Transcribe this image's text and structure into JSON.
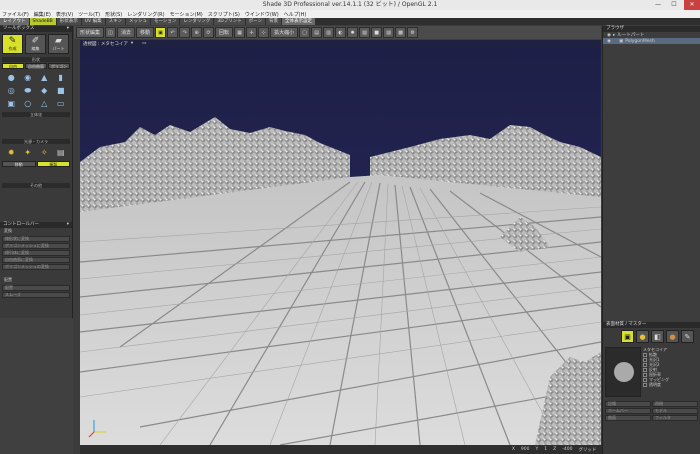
{
  "window": {
    "title": "Shade 3D Professional ver.14.1.1 (32 ビット) / OpenGL 2.1"
  },
  "menu": [
    "ファイル(F)",
    "編集(E)",
    "表示(V)",
    "ツール(T)",
    "形状(S)",
    "レンダリング(R)",
    "モーション(M)",
    "スクリプト(S)",
    "ウインドウ(W)",
    "ヘルプ(H)"
  ],
  "tabs": [
    {
      "label": "レイアウト",
      "state": "on"
    },
    {
      "label": "ShadeBB",
      "state": "hl"
    },
    {
      "label": "形状表示",
      "state": ""
    },
    {
      "label": "UV 編集",
      "state": ""
    },
    {
      "label": "スキン",
      "state": ""
    },
    {
      "label": "メッシュ",
      "state": ""
    },
    {
      "label": "モーション",
      "state": ""
    },
    {
      "label": "レンダリング",
      "state": ""
    },
    {
      "label": "3Dプリント",
      "state": ""
    },
    {
      "label": "ボーン",
      "state": ""
    },
    {
      "label": "背景",
      "state": ""
    },
    {
      "label": "全体表示設定",
      "state": "on"
    }
  ],
  "toolbox": {
    "header": "ツールボックス",
    "big_buttons": [
      "作成",
      "編集",
      "パート"
    ],
    "section_basic": "形状",
    "toggles": [
      "自由",
      "自由曲面",
      "ポリゴン"
    ],
    "section_solid": "立体化",
    "section_light": "光源・カメラ",
    "mode_toggles": [
      "移動",
      "複製"
    ],
    "section_bottom": "その他"
  },
  "left_lower": {
    "header": "コントロールバー",
    "section1": "変換",
    "rows1": [
      "線形状に変換",
      "ポリゴンメッシュに変換",
      "掃引体に変換",
      "自由曲面に変換",
      "ポリゴンメッシュの変換"
    ],
    "section2": "配置",
    "rows2": [
      "配置",
      "スムーズ"
    ]
  },
  "toolbar": {
    "items": [
      "形状編集",
      "消去",
      "移動",
      "回転",
      "拡大縮小"
    ],
    "active": "移動"
  },
  "viewport": {
    "label": "透視図 : メタセコイア"
  },
  "status": {
    "x": "X",
    "x_val": "900",
    "y": "Y",
    "y_val": "1",
    "z": "Z",
    "z_val": "-400",
    "grid_label": "グリッド",
    "grid_val": "1272",
    "unit_label": "mm",
    "snap": "スナップ",
    "snap_val": "18",
    "zoom_label": "表示",
    "zoom_val": "100"
  },
  "browser": {
    "header": "ブラウザ",
    "items": [
      {
        "label": "ルートパート",
        "selected": false
      },
      {
        "label": "PolygonMesh",
        "selected": true
      }
    ]
  },
  "material": {
    "header": "表面材質 / マスター",
    "tabs": [
      "表面材質",
      "カラー",
      "背景",
      "光源",
      "ボーン"
    ],
    "active_tab": 0,
    "rows": [
      "メタセコイア",
      "拡散",
      "光沢1",
      "光沢2",
      "反射",
      "屈折率",
      "マッピング",
      "透明度"
    ],
    "props": [
      "記憶",
      "再現",
      "ホームバー",
      "モデル",
      "曲面",
      "フィルタ"
    ]
  },
  "colors": {
    "accent": "#d7e02a",
    "sky": "#232550",
    "ground": "#cfcfcf"
  }
}
